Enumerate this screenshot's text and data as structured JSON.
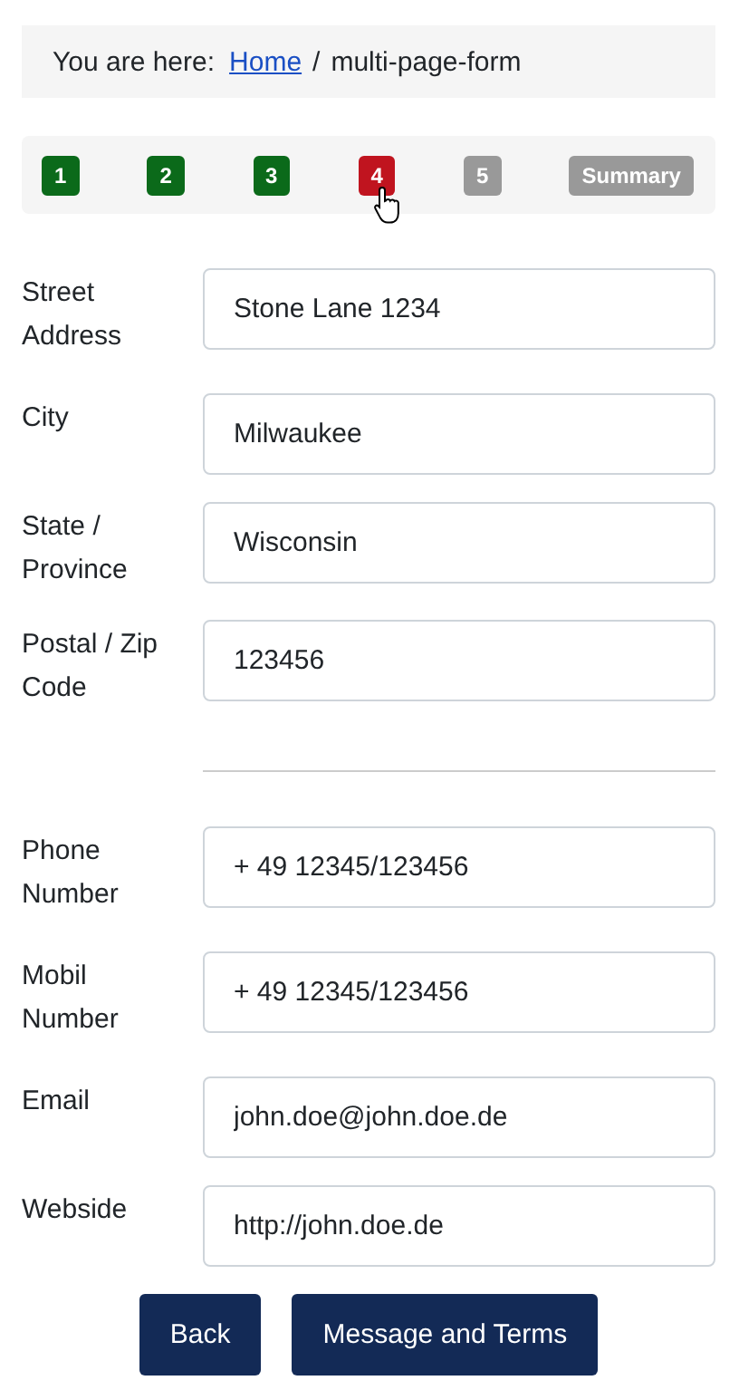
{
  "breadcrumb": {
    "prefix": "You are here:",
    "link": "Home",
    "separator": "/",
    "current": "multi-page-form"
  },
  "steps": [
    {
      "label": "1",
      "completed": true,
      "selected": false
    },
    {
      "label": "2",
      "completed": true,
      "selected": false
    },
    {
      "label": "3",
      "completed": true,
      "selected": false
    },
    {
      "label": "4",
      "completed": false,
      "selected": true
    },
    {
      "label": "5",
      "completed": false,
      "selected": false
    },
    {
      "label": "Summary",
      "completed": false,
      "selected": false
    }
  ],
  "address_fields": [
    {
      "label": "Street Address",
      "value": "Stone Lane 1234"
    },
    {
      "label": "City",
      "value": "Milwaukee"
    },
    {
      "label": "State / Province",
      "value": "Wisconsin"
    },
    {
      "label": "Postal / Zip Code",
      "value": "123456"
    }
  ],
  "contact_fields": [
    {
      "label": "Phone Number",
      "value": "+ 49 12345/123456"
    },
    {
      "label": "Mobil Number",
      "value": "+ 49 12345/123456"
    },
    {
      "label": "Email",
      "value": "john.doe@john.doe.de"
    },
    {
      "label": "Webside",
      "value": "http://john.doe.de"
    }
  ],
  "buttons": [
    "Back",
    "Message and Terms"
  ]
}
